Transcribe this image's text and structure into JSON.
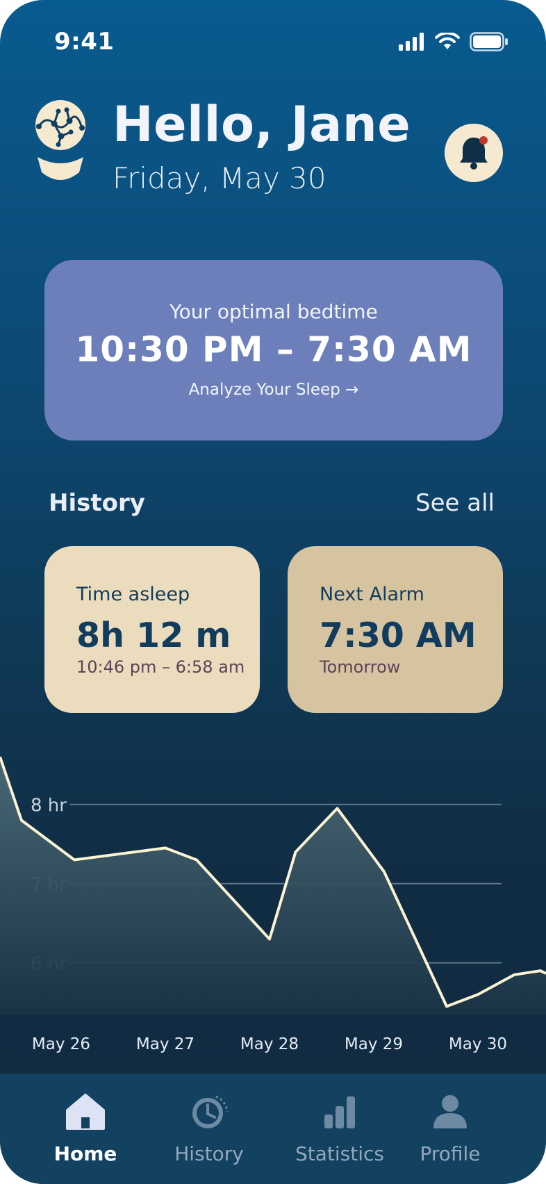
{
  "status_bar": {
    "time": "9:41"
  },
  "header": {
    "greeting": "Hello, Jane",
    "date": "Friday, May 30"
  },
  "bedtime_card": {
    "label": "Your optimal bedtime",
    "time_range": "10:30 PM – 7:30 AM",
    "link": "Analyze Your Sleep →"
  },
  "history": {
    "title": "History",
    "see_all": "See all"
  },
  "stats": [
    {
      "label": "Time asleep",
      "value": "8h 12 m",
      "sub": "10:46 pm – 6:58 am"
    },
    {
      "label": "Next Alarm",
      "value": "7:30 AM",
      "sub": "Tomorrow"
    }
  ],
  "chart_data": {
    "type": "area",
    "x": [
      "May 26",
      "May 27",
      "May 28",
      "May 29",
      "May 30"
    ],
    "y_ticks": [
      "8 hr",
      "7 hr",
      "6 hr"
    ],
    "series": [
      {
        "points": [
          [
            0.0,
            8.6
          ],
          [
            0.13,
            7.8
          ],
          [
            0.45,
            7.3
          ],
          [
            1.0,
            7.45
          ],
          [
            1.3,
            7.3
          ],
          [
            2.0,
            6.3
          ],
          [
            2.25,
            7.4
          ],
          [
            2.65,
            7.95
          ],
          [
            3.1,
            7.15
          ],
          [
            3.4,
            6.3
          ],
          [
            3.7,
            5.45
          ],
          [
            4.0,
            5.6
          ],
          [
            4.35,
            5.85
          ],
          [
            4.6,
            5.9
          ]
        ]
      }
    ],
    "ylim": [
      4.5,
      9.0
    ],
    "grid": true,
    "colors": {
      "line": "#fbf3d2",
      "grid": "#5b7488",
      "fill_top": "#4c6a76",
      "fill_bottom": "#1a3446"
    }
  },
  "tabbar": {
    "items": [
      {
        "label": "Home",
        "icon": "home-icon",
        "active": true
      },
      {
        "label": "History",
        "icon": "clock-icon",
        "active": false
      },
      {
        "label": "Statistics",
        "icon": "bar-chart-icon",
        "active": false
      },
      {
        "label": "Profile",
        "icon": "person-icon",
        "active": false
      }
    ]
  },
  "colors": {
    "accent_cream": "#f5ead0",
    "card_purple": "#6d7fba",
    "text_dark_blue": "#123c5e",
    "notification_dot": "#c0392b"
  }
}
